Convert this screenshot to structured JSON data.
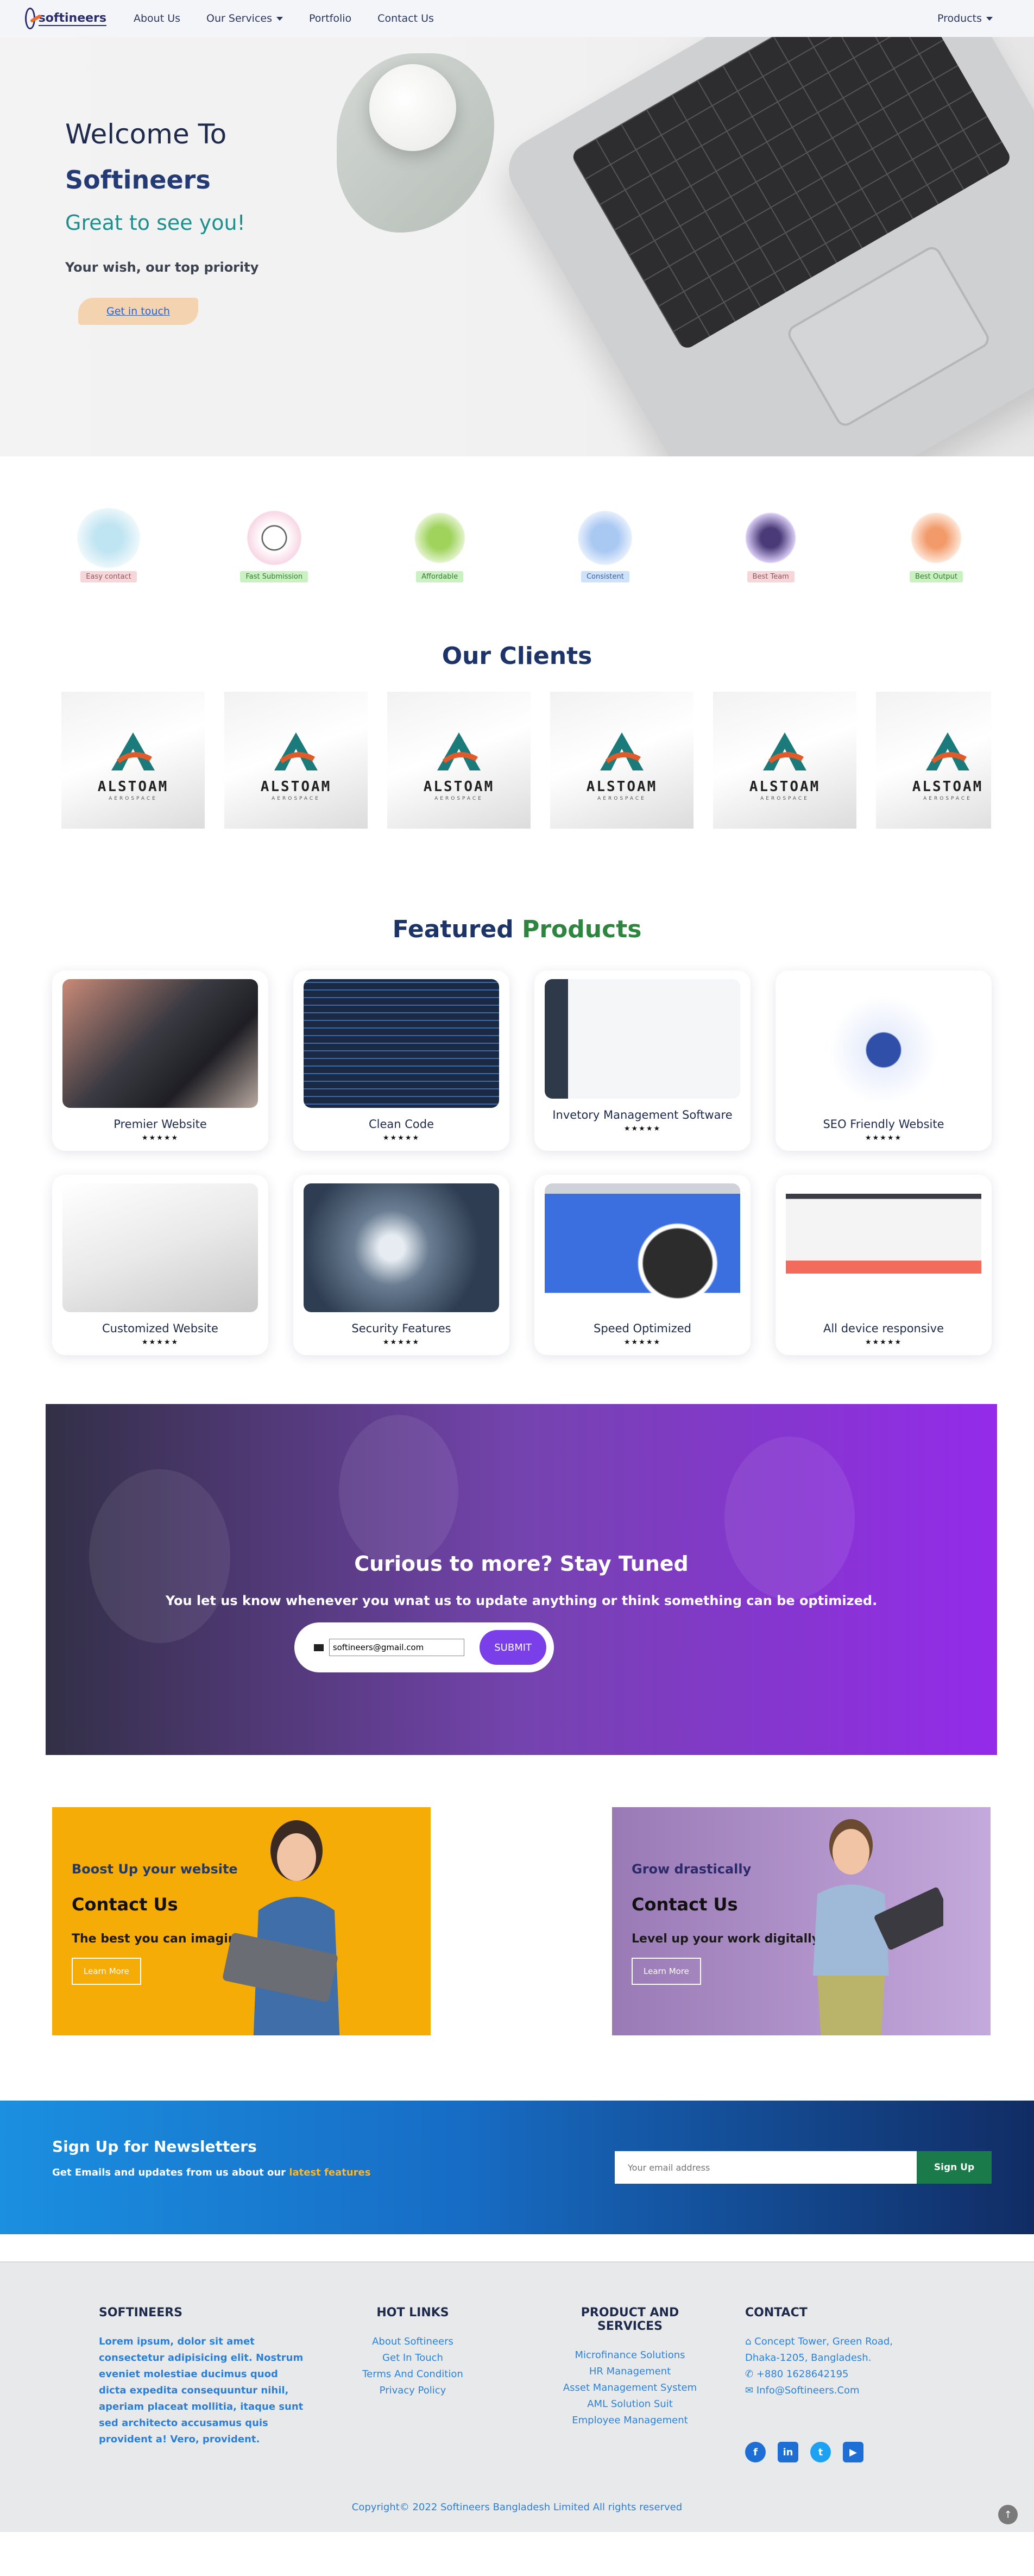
{
  "nav": {
    "logo_text": "softineers",
    "links": [
      "About Us",
      "Our Services",
      "Portfolio",
      "Contact Us"
    ],
    "products": "Products"
  },
  "hero": {
    "line1": "Welcome To",
    "line2": "Softineers",
    "line3": "Great to see you!",
    "tagline": "Your wish, our top priority",
    "cta": "Get in touch"
  },
  "features": [
    {
      "label": "Easy contact",
      "bg": "#f7d6d9",
      "color": "#8a5a60"
    },
    {
      "label": "Fast Submission",
      "bg": "#c9f1c2",
      "color": "#3a7a33"
    },
    {
      "label": "Affordable",
      "bg": "#c9f1c2",
      "color": "#3a7a33"
    },
    {
      "label": "Consistent",
      "bg": "#cfe2fb",
      "color": "#3a5e9a"
    },
    {
      "label": "Best Team",
      "bg": "#f7d6d9",
      "color": "#8a5a60"
    },
    {
      "label": "Best Output",
      "bg": "#c9f1c2",
      "color": "#3a7a33"
    }
  ],
  "clients": {
    "title": "Our Clients",
    "logo_name": "ALSTOAM",
    "logo_sub": "AEROSPACE"
  },
  "products": {
    "title_part1": "Featured",
    "title_part2": "Products",
    "stars": "★★★★★",
    "items": [
      {
        "name": "Premier Website"
      },
      {
        "name": "Clean Code"
      },
      {
        "name": "Invetory Management Software"
      },
      {
        "name": "SEO Friendly Website"
      },
      {
        "name": "Customized Website"
      },
      {
        "name": "Security Features"
      },
      {
        "name": "Speed Optimized"
      },
      {
        "name": "All device responsive"
      }
    ]
  },
  "stay_tuned": {
    "title": "Curious to more? Stay Tuned",
    "subtitle": "You let us know whenever you wnat us to update anything or think something can be optimized.",
    "email_value": "softineers@gmail.com",
    "submit": "SUBMIT"
  },
  "promos": [
    {
      "kicker": "Boost Up your website",
      "title": "Contact Us",
      "text": "The best you can imagine",
      "button": "Learn More",
      "kicker_color": "#1e3a6e"
    },
    {
      "kicker": "Grow drastically",
      "title": "Contact Us",
      "text": "Level up your work digitally",
      "button": "Learn More",
      "kicker_color": "#2b2a6a"
    }
  ],
  "signup": {
    "title": "Sign Up for Newsletters",
    "sub_prefix": "Get Emails and updates from us about our",
    "sub_highlight": "latest features",
    "placeholder": "Your email address",
    "button": "Sign Up"
  },
  "footer": {
    "about_title": "SOFTINEERS",
    "about_text": "Lorem ipsum, dolor sit amet consectetur adipisicing elit. Nostrum eveniet molestiae ducimus quod dicta expedita consequuntur nihil, aperiam placeat mollitia, itaque sunt sed architecto accusamus quis provident a! Vero, provident.",
    "links_title": "HOT LINKS",
    "links": [
      "About Softineers",
      "Get In Touch",
      "Terms And Condition",
      "Privacy Policy"
    ],
    "services_title": "PRODUCT AND SERVICES",
    "services": [
      "Microfinance Solutions",
      "HR Management",
      "Asset Management System",
      "AML Solution Suit",
      "Employee Management"
    ],
    "contact_title": "CONTACT",
    "address1": "Concept Tower, Green Road,",
    "address2": "Dhaka-1205, Bangladesh.",
    "phone": "+880 1628642195",
    "email": "Info@Softineers.Com",
    "copyright": "Copyright© 2022 Softineers Bangladesh Limited All rights reserved"
  }
}
